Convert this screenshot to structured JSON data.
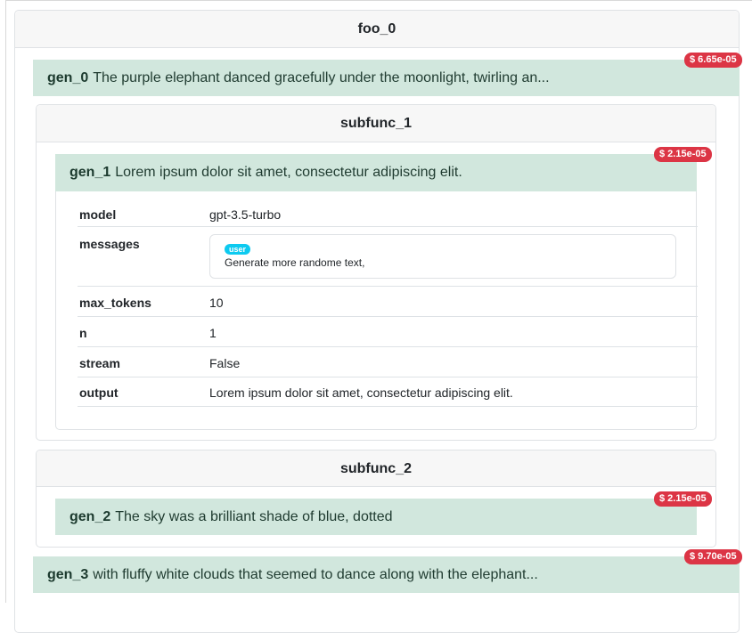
{
  "colors": {
    "gen_bg": "#d1e7dd",
    "cost_badge": "#dc3545",
    "role_badge": "#0dcaf0",
    "header_bg": "#f7f7f7"
  },
  "foo_0": {
    "title": "foo_0",
    "gen_0": {
      "name": "gen_0",
      "text": "The purple elephant danced gracefully under the moonlight, twirling an...",
      "cost": "$ 6.65e-05"
    },
    "subfunc_1": {
      "title": "subfunc_1",
      "gen_1": {
        "name": "gen_1",
        "text": "Lorem ipsum dolor sit amet, consectetur adipiscing elit.",
        "cost": "$ 2.15e-05",
        "details": {
          "model_key": "model",
          "model_val": "gpt-3.5-turbo",
          "messages_key": "messages",
          "message_role": "user",
          "message_text": "Generate more randome text,",
          "max_tokens_key": "max_tokens",
          "max_tokens_val": "10",
          "n_key": "n",
          "n_val": "1",
          "stream_key": "stream",
          "stream_val": "False",
          "output_key": "output",
          "output_val": "Lorem ipsum dolor sit amet, consectetur adipiscing elit."
        }
      }
    },
    "subfunc_2": {
      "title": "subfunc_2",
      "gen_2": {
        "name": "gen_2",
        "text": "The sky was a brilliant shade of blue, dotted",
        "cost": "$ 2.15e-05"
      }
    },
    "gen_3": {
      "name": "gen_3",
      "text": "with fluffy white clouds that seemed to dance along with the elephant...",
      "cost": "$ 9.70e-05"
    }
  }
}
